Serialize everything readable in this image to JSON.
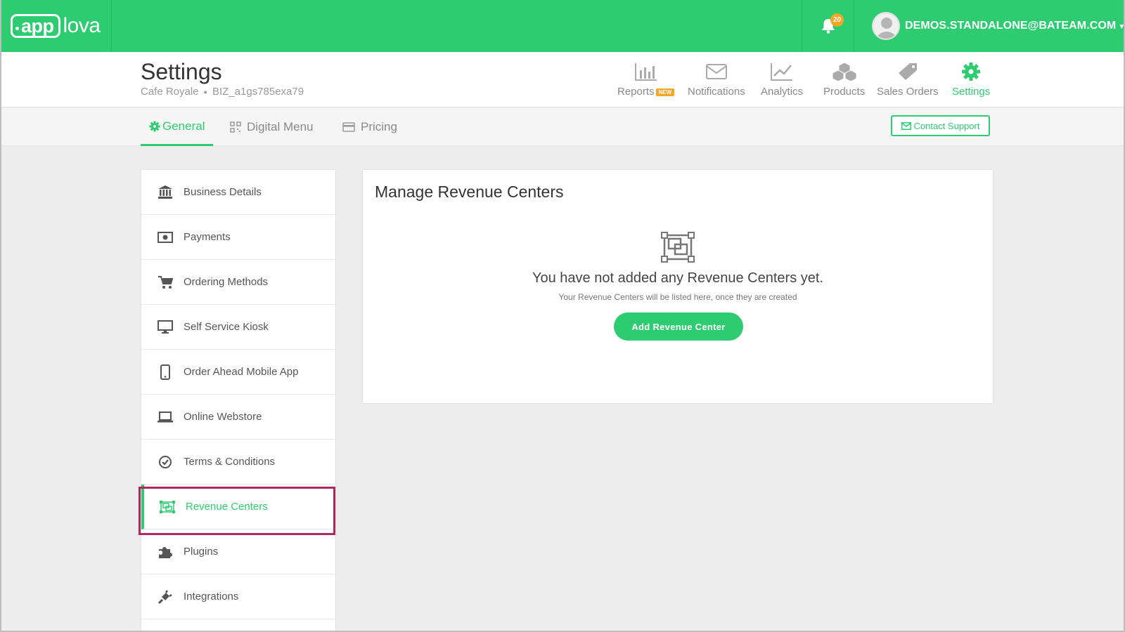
{
  "brand": {
    "logo_app": "app",
    "logo_lova": "lova",
    "accent_color": "#2ecc71",
    "badge_color": "#f5a623"
  },
  "topbar": {
    "notification_count": "20",
    "user_email": "DEMOS.STANDALONE@BATEAM.COM"
  },
  "header": {
    "title": "Settings",
    "business_name": "Cafe Royale",
    "business_id": "BIZ_a1gs785exa79"
  },
  "topnav": [
    {
      "label": "Reports",
      "icon": "bar-chart-icon",
      "badge": "NEW"
    },
    {
      "label": "Notifications",
      "icon": "envelope-icon"
    },
    {
      "label": "Analytics",
      "icon": "line-chart-icon"
    },
    {
      "label": "Products",
      "icon": "cubes-icon"
    },
    {
      "label": "Sales Orders",
      "icon": "tag-icon"
    },
    {
      "label": "Settings",
      "icon": "gear-icon",
      "active": true
    }
  ],
  "tabs": [
    {
      "label": "General",
      "icon": "gear-icon",
      "active": true
    },
    {
      "label": "Digital Menu",
      "icon": "qr-code-icon"
    },
    {
      "label": "Pricing",
      "icon": "credit-card-icon"
    }
  ],
  "contact_support_label": "Contact Support",
  "sidebar": {
    "items": [
      {
        "label": "Business Details",
        "icon": "bank-icon"
      },
      {
        "label": "Payments",
        "icon": "money-icon"
      },
      {
        "label": "Ordering Methods",
        "icon": "cart-icon"
      },
      {
        "label": "Self Service Kiosk",
        "icon": "desktop-icon"
      },
      {
        "label": "Order Ahead Mobile App",
        "icon": "mobile-icon"
      },
      {
        "label": "Online Webstore",
        "icon": "laptop-icon"
      },
      {
        "label": "Terms & Conditions",
        "icon": "check-circle-icon"
      },
      {
        "label": "Revenue Centers",
        "icon": "object-group-icon",
        "active": true
      },
      {
        "label": "Plugins",
        "icon": "puzzle-icon"
      },
      {
        "label": "Integrations",
        "icon": "plug-icon"
      }
    ]
  },
  "main": {
    "title": "Manage Revenue Centers",
    "empty_title": "You have not added any Revenue Centers yet.",
    "empty_subtitle": "Your Revenue Centers will be listed here, once they are created",
    "add_button_label": "Add Revenue Center"
  }
}
